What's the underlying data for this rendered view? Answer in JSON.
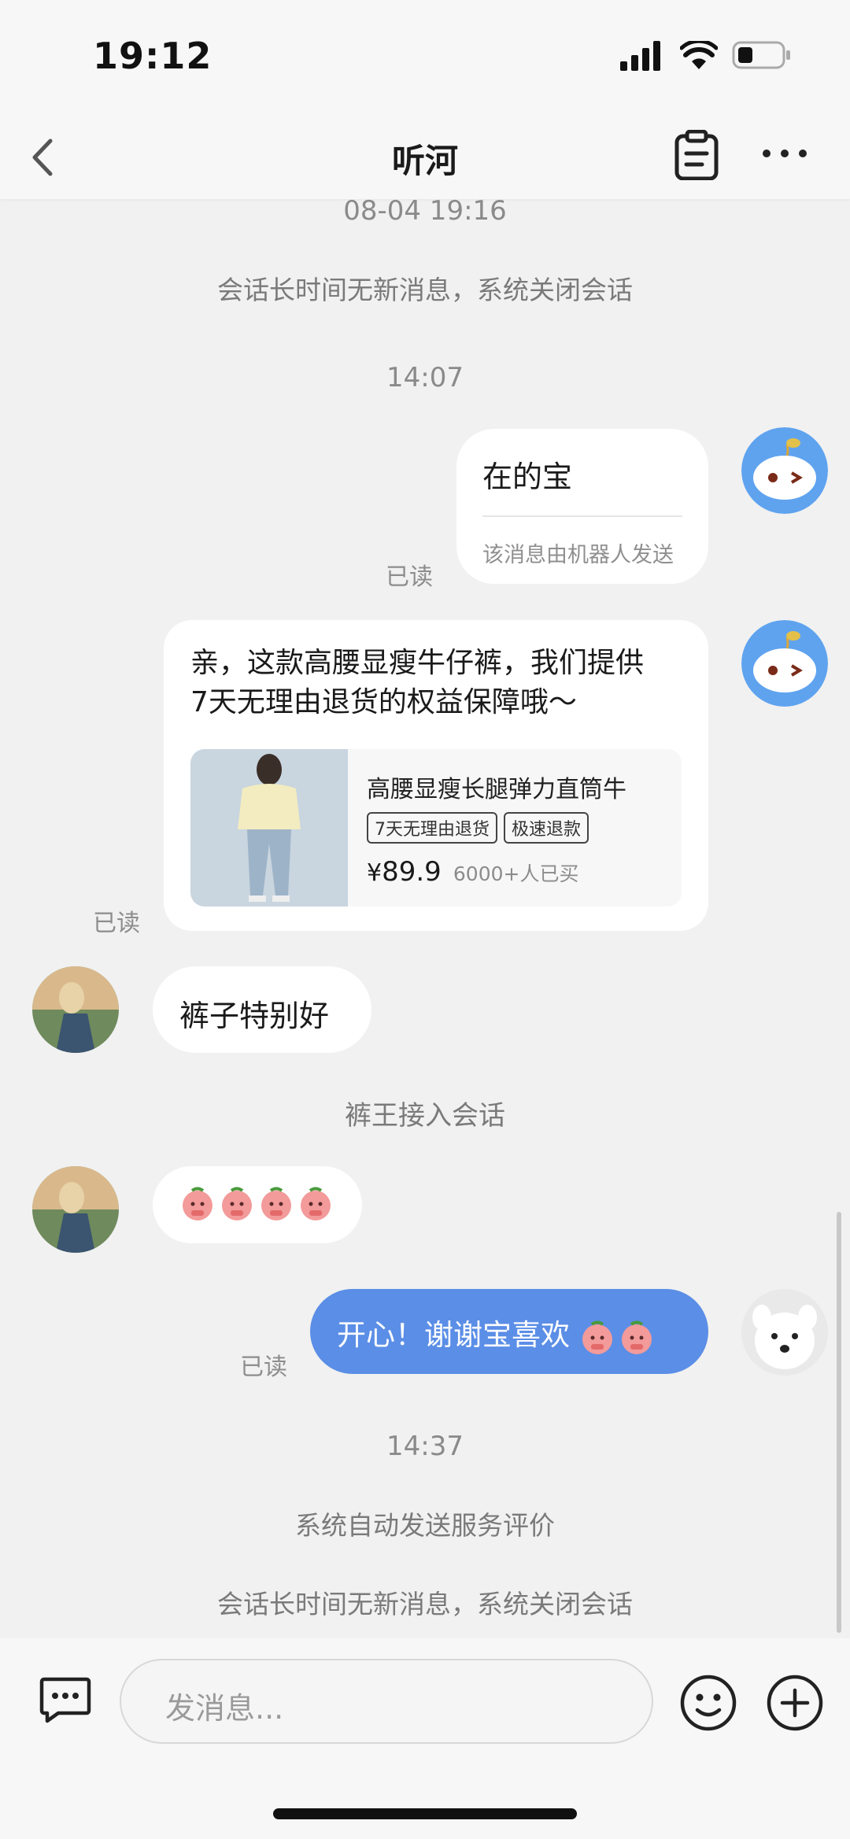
{
  "status_bar": {
    "time": "19:12"
  },
  "header": {
    "title": "听河"
  },
  "messages": {
    "stamp1": "08-04 19:16",
    "sys1": "会话长时间无新消息，系统关闭会话",
    "stamp2": "14:07",
    "bot1_text": "在的宝",
    "bot1_note": "该消息由机器人发送",
    "read_label": "已读",
    "bot2_text_line1": "亲，这款高腰显瘦牛仔裤，我们提供",
    "bot2_text_line2": "7天无理由退货的权益保障哦～",
    "product": {
      "name": "高腰显瘦长腿弹力直筒牛",
      "tags": [
        "7天无理由退货",
        "极速退款"
      ],
      "currency": "¥",
      "price": "89.9",
      "sales": "6000+人已买"
    },
    "user1_text": "裤子特别好",
    "sys2": "裤王接入会话",
    "agent_text": "开心！谢谢宝喜欢",
    "stamp3": "14:37",
    "sys3": "系统自动发送服务评价",
    "sys4": "会话长时间无新消息，系统关闭会话"
  },
  "input": {
    "placeholder": "发消息..."
  },
  "colors": {
    "agent_bubble": "#5b8ee6",
    "background": "#f1f1f1"
  },
  "icons": [
    "back-icon",
    "clipboard-icon",
    "more-icon",
    "chat-menu-icon",
    "emoji-icon",
    "plus-icon",
    "bot-avatar-icon"
  ]
}
